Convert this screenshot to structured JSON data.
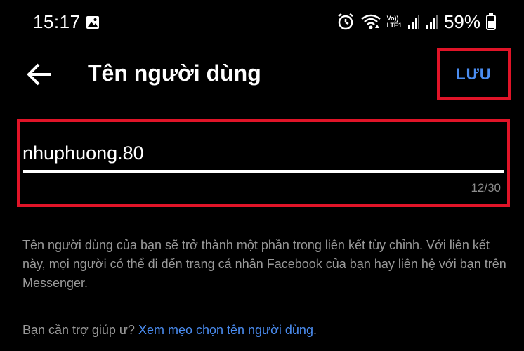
{
  "status_bar": {
    "time": "15:17",
    "battery": "59%",
    "network_label_top": "Vo))",
    "network_label_bottom": "LTE1"
  },
  "header": {
    "title": "Tên người dùng",
    "save_label": "LƯU"
  },
  "username_field": {
    "value": "nhuphuong.80",
    "counter": "12/30"
  },
  "description": "Tên người dùng của bạn sẽ trở thành một phần trong liên kết tùy chỉnh. Với liên kết này, mọi người có thể đi đến trang cá nhân Facebook của bạn hay liên hệ với bạn trên Messenger.",
  "help": {
    "prefix": "Bạn cần trợ giúp ư? ",
    "link": "Xem mẹo chọn tên người dùng",
    "suffix": "."
  },
  "colors": {
    "background": "#000000",
    "accent": "#4a8cf0",
    "highlight": "#e01428"
  }
}
